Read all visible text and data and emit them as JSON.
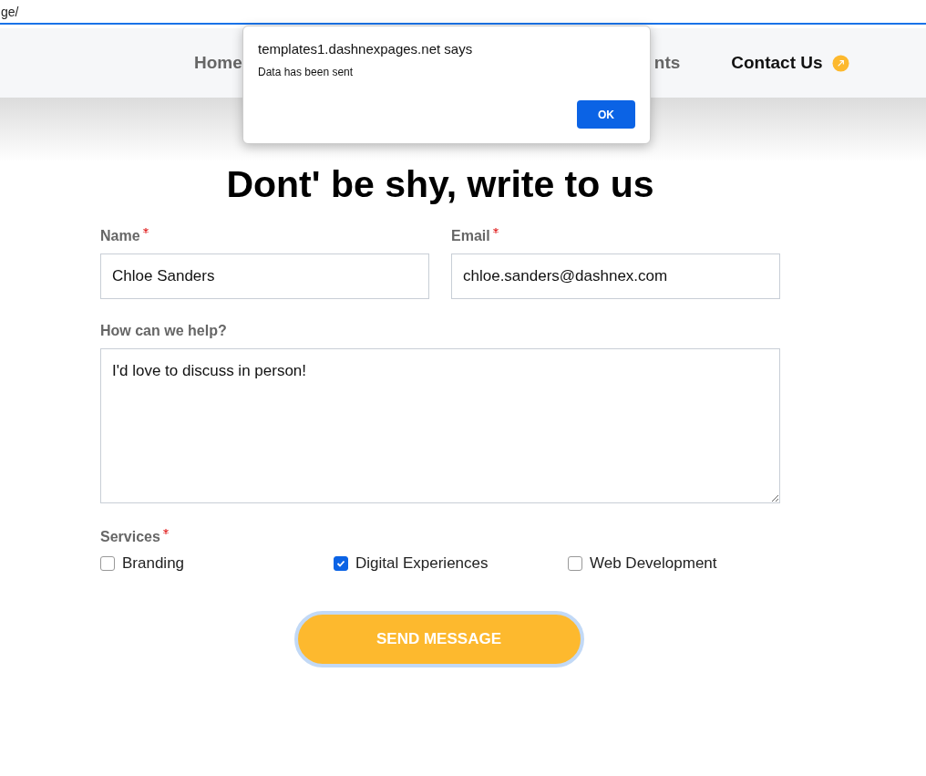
{
  "address_bar": {
    "url": "ge/"
  },
  "nav": {
    "items": [
      {
        "label": "Home",
        "selected": false
      },
      {
        "label": "nts",
        "selected": false
      },
      {
        "label": "Contact Us",
        "selected": true
      }
    ]
  },
  "dialog": {
    "title": "templates1.dashnexpages.net says",
    "message": "Data has been sent",
    "button": "OK"
  },
  "form": {
    "heading": "Dont' be shy, write to us",
    "fields": [
      {
        "label": "Name",
        "required": true,
        "value": "Chloe Sanders"
      },
      {
        "label": "Email",
        "required": true,
        "value": "chloe.sanders@dashnex.com"
      }
    ],
    "message": {
      "label": "How can we help?",
      "value": "I'd love to discuss in person!"
    },
    "services": {
      "label": "Services",
      "required": true,
      "options": [
        {
          "label": "Branding",
          "checked": false
        },
        {
          "label": "Digital Experiences",
          "checked": true
        },
        {
          "label": "Web Development",
          "checked": false
        }
      ]
    },
    "submit": "SEND MESSAGE"
  }
}
